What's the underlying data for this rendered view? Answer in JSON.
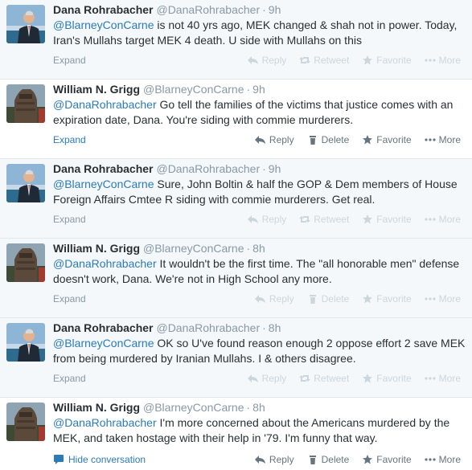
{
  "colors": {
    "link": "#2b7bb9",
    "meta": "#8899a6",
    "action_faint": "#ccd6dd",
    "action_dark": "#66757f"
  },
  "actions": {
    "reply": "Reply",
    "retweet": "Retweet",
    "delete": "Delete",
    "favorite": "Favorite",
    "more": "More"
  },
  "tweets": [
    {
      "name": "Dana Rohrabacher",
      "handle": "@DanaRohrabacher",
      "separator": "·",
      "time": "9h",
      "mention": "@BlarneyConCarne",
      "text": " is not 40 yrs ago, MEK changed & shah not in power. Today, Iran's Mullahs target MEK 4 death. U side with Mullahs on this",
      "expand": "Expand"
    },
    {
      "name": "William N. Grigg",
      "handle": "@BlarneyConCarne",
      "separator": "·",
      "time": "9h",
      "mention": "@DanaRohrabacher",
      "text": " Go tell the families of the victims that justice comes with an expiration date, Dana. You're siding with commie murderers.",
      "expand": "Expand"
    },
    {
      "name": "Dana Rohrabacher",
      "handle": "@DanaRohrabacher",
      "separator": "·",
      "time": "9h",
      "mention": "@BlarneyConCarne",
      "text": " Sure, John Boltin & half the GOP & Dem members of House Foreign Affairs Cmtee R siding with commie murderers. Get real.",
      "expand": "Expand"
    },
    {
      "name": "William N. Grigg",
      "handle": "@BlarneyConCarne",
      "separator": "·",
      "time": "8h",
      "mention": "@DanaRohrabacher",
      "text": " It wouldn't be the first time. The \"all honorable men\" defense doesn't work, Dana. We're not in High School any more.",
      "expand": "Expand"
    },
    {
      "name": "Dana Rohrabacher",
      "handle": "@DanaRohrabacher",
      "separator": "·",
      "time": "8h",
      "mention": "@BlarneyConCarne",
      "text": " OK so U've found reason enough 2 oppose effort 2 save MEK from being murdered by Iranian Mullahs. I & others disagree.",
      "expand": "Expand"
    },
    {
      "name": "William N. Grigg",
      "handle": "@BlarneyConCarne",
      "separator": "·",
      "time": "8h",
      "mention": "@DanaRohrabacher",
      "text": " I'm more concerned about the Americans murdered by the MEK, and taken hostage with their help in '79. I'm funny that way.",
      "hide_conversation": "Hide conversation"
    }
  ]
}
